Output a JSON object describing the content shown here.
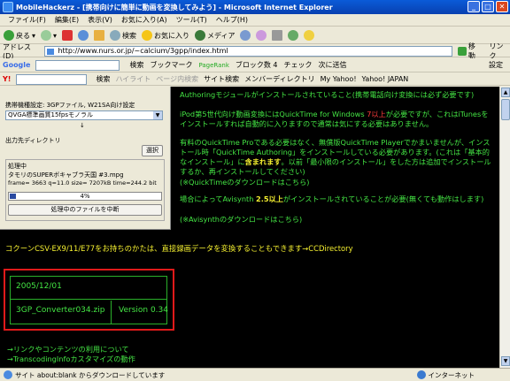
{
  "window": {
    "title": "MobileHackerz - [携帯向けに簡単に動画を変換してみよう] - Microsoft Internet Explorer"
  },
  "menu": [
    "ファイル(F)",
    "編集(E)",
    "表示(V)",
    "お気に入り(A)",
    "ツール(T)",
    "ヘルプ(H)"
  ],
  "toolbar": {
    "back": "戻る",
    "search": "検索",
    "favorites": "お気に入り",
    "media": "メディア"
  },
  "address": {
    "label": "アドレス(D)",
    "url": "http://www.nurs.or.jp/~calcium/3gpp/index.html",
    "go": "移動",
    "links": "リンク"
  },
  "google": {
    "logo": "Google",
    "search": "検索",
    "bookmarks": "ブックマーク",
    "pagerank": "PageRank",
    "blocked": "ブロック数 4",
    "check": "チェック",
    "next": "次に送信",
    "settings": "設定"
  },
  "yahoo": {
    "search": "検索",
    "highlight": "ハイライト",
    "page_search": "ページ内検索",
    "site_search": "サイト検索",
    "member_dir": "メンバーディレクトリ",
    "my_yahoo": "My Yahoo!",
    "yahoo_japan": "Yahoo! JAPAN"
  },
  "panel": {
    "preset_label": "携帯機種設定: 3GPファイル, W21SA向け設定",
    "preset_value": "QVGA標準画質15fpsモノラル",
    "output_label": "出力先ディレクトリ",
    "select_button": "選択",
    "processing_label": "処理中",
    "file_line": "タモリのSUPERボキャブラ天国  #3.mpg",
    "stats_line": "frame= 3663 q=11.0 size=    7207kB time=244.2 bit",
    "progress_value": 4,
    "progress_text": "4%",
    "cancel_button": "処理中のファイルを中断"
  },
  "body": {
    "p1": "Authoringモジュールがインストールされていること(携帯電話向け変換には必ず必要です)",
    "p2a": "iPod第5世代向け動画変換にはQuickTime for Windows ",
    "p2b": "7以上",
    "p2c": "が必要ですが、これはiTunesをインストールすれば自動的に入りますので通常は気にする必要はありません。",
    "p3a": "有料のQuickTime Proである必要はなく、無償版QuickTime Playerでかまいませんが、インストール時「QuickTime Authoring」をインストールしている必要があります。(これは「基本的なインストール」に",
    "p3b": "含まれます",
    "p3c": "。以前「最小限のインストール」をした方は追加でインストールするか、再インストールしてください)",
    "p3d": "(※QuickTimeのダウンロードはこちら)",
    "p4a": "場合によってAvisynth ",
    "p4b": "2.5以上",
    "p4c": "がインストールされていることが必要(無くても動作はします)",
    "p4d": "(※Avisynthのダウンロードはこちら)",
    "ccd": "コクーンCSV-EX9/11/E77をお持ちのかたは、直接録画データを変換することもできます→CCDirectory",
    "link1": "→リンクやコンテンツの利用について",
    "link2": "→TranscodingInfoカスタマイズの動作"
  },
  "download": {
    "date": "2005/12/01",
    "file": "3GP_Converter034.zip",
    "version": "Version 0.34"
  },
  "status": {
    "text": "サイト about:blank からダウンロードしています",
    "zone": "インターネット"
  },
  "colors": {
    "green": "#44e544",
    "yellow": "#f5f030",
    "red": "#ff3d3d",
    "highlight_box": "#e01a1a"
  }
}
